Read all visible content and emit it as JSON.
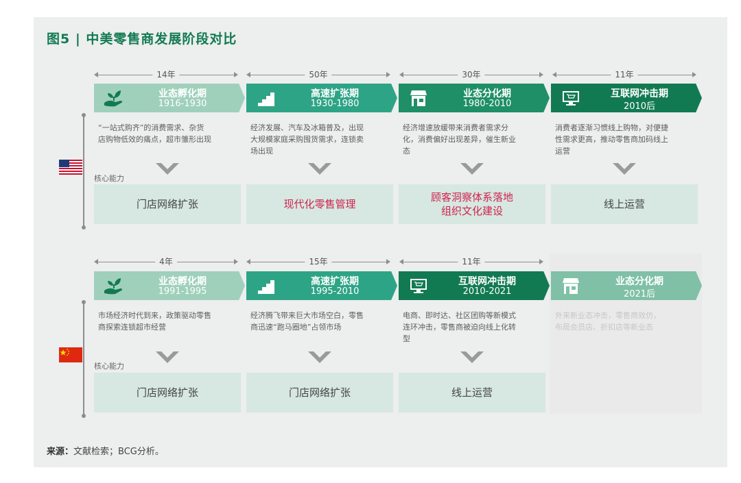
{
  "title": "图5 | 中美零售商发展阶段对比",
  "core_label": "核心能力",
  "source": {
    "label": "来源：",
    "text": "文献检索；BCG分析。"
  },
  "us": {
    "durations": [
      "14年",
      "50年",
      "30年",
      "11年"
    ],
    "stages": [
      {
        "name": "业态孵化期",
        "years": "1916-1930",
        "icon": "sprout-hand-icon"
      },
      {
        "name": "高速扩张期",
        "years": "1930-1980",
        "icon": "stairs-icon"
      },
      {
        "name": "业态分化期",
        "years": "1980-2010",
        "icon": "store-icon"
      },
      {
        "name": "互联网冲击期",
        "years": "2010后",
        "icon": "computer-cart-icon"
      }
    ],
    "descriptions": [
      [
        "“一站式购齐”的消费需求、杂货",
        "店购物低效的痛点，超市雏形出现"
      ],
      [
        "经济发展、汽车及冰箱普及，出现",
        "大规模家庭采购囤货需求，连锁卖",
        "场出现"
      ],
      [
        "经济增速放缓带来消费者需求分",
        "化，消费偏好出现差异，催生新业",
        "态"
      ],
      [
        "消费者逐渐习惯线上购物，对便捷",
        "性需求更高，推动零售商加码线上",
        "运营"
      ]
    ],
    "abilities": [
      [
        "门店网络扩张"
      ],
      [
        "现代化零售管理"
      ],
      [
        "顾客洞察体系落地",
        "组织文化建设"
      ],
      [
        "线上运营"
      ]
    ]
  },
  "cn": {
    "durations": [
      "4年",
      "15年",
      "11年"
    ],
    "stages": [
      {
        "name": "业态孵化期",
        "years": "1991-1995",
        "icon": "sprout-hand-icon"
      },
      {
        "name": "高速扩张期",
        "years": "1995-2010",
        "icon": "stairs-icon"
      },
      {
        "name": "互联网冲击期",
        "years": "2010-2021",
        "icon": "computer-cart-icon"
      },
      {
        "name": "业态分化期",
        "years": "2021后",
        "icon": "store-icon"
      }
    ],
    "descriptions": [
      [
        "市场经济时代到来，政策驱动零售",
        "商探索连锁超市经营"
      ],
      [
        "经济腾飞带来巨大市场空白，零售",
        "商迅速“跑马圈地”占领市场"
      ],
      [
        "电商、即时达、社区团购等新模式",
        "连环冲击，零售商被迫向线上化转",
        "型"
      ],
      [
        "外来新业态冲击，零售商效仿，",
        "布局会员店、折扣店等新业态"
      ]
    ],
    "abilities": [
      [
        "门店网络扩张"
      ],
      [
        "门店网络扩张"
      ],
      [
        "线上运营"
      ]
    ]
  },
  "colors": {
    "stage1": "#9fd0bb",
    "stage2": "#2ea486",
    "stage3": "#1f8f67",
    "stage4": "#127a52",
    "future": "#7fc0a6",
    "highlight": "#d0224f",
    "title": "#127a52"
  }
}
